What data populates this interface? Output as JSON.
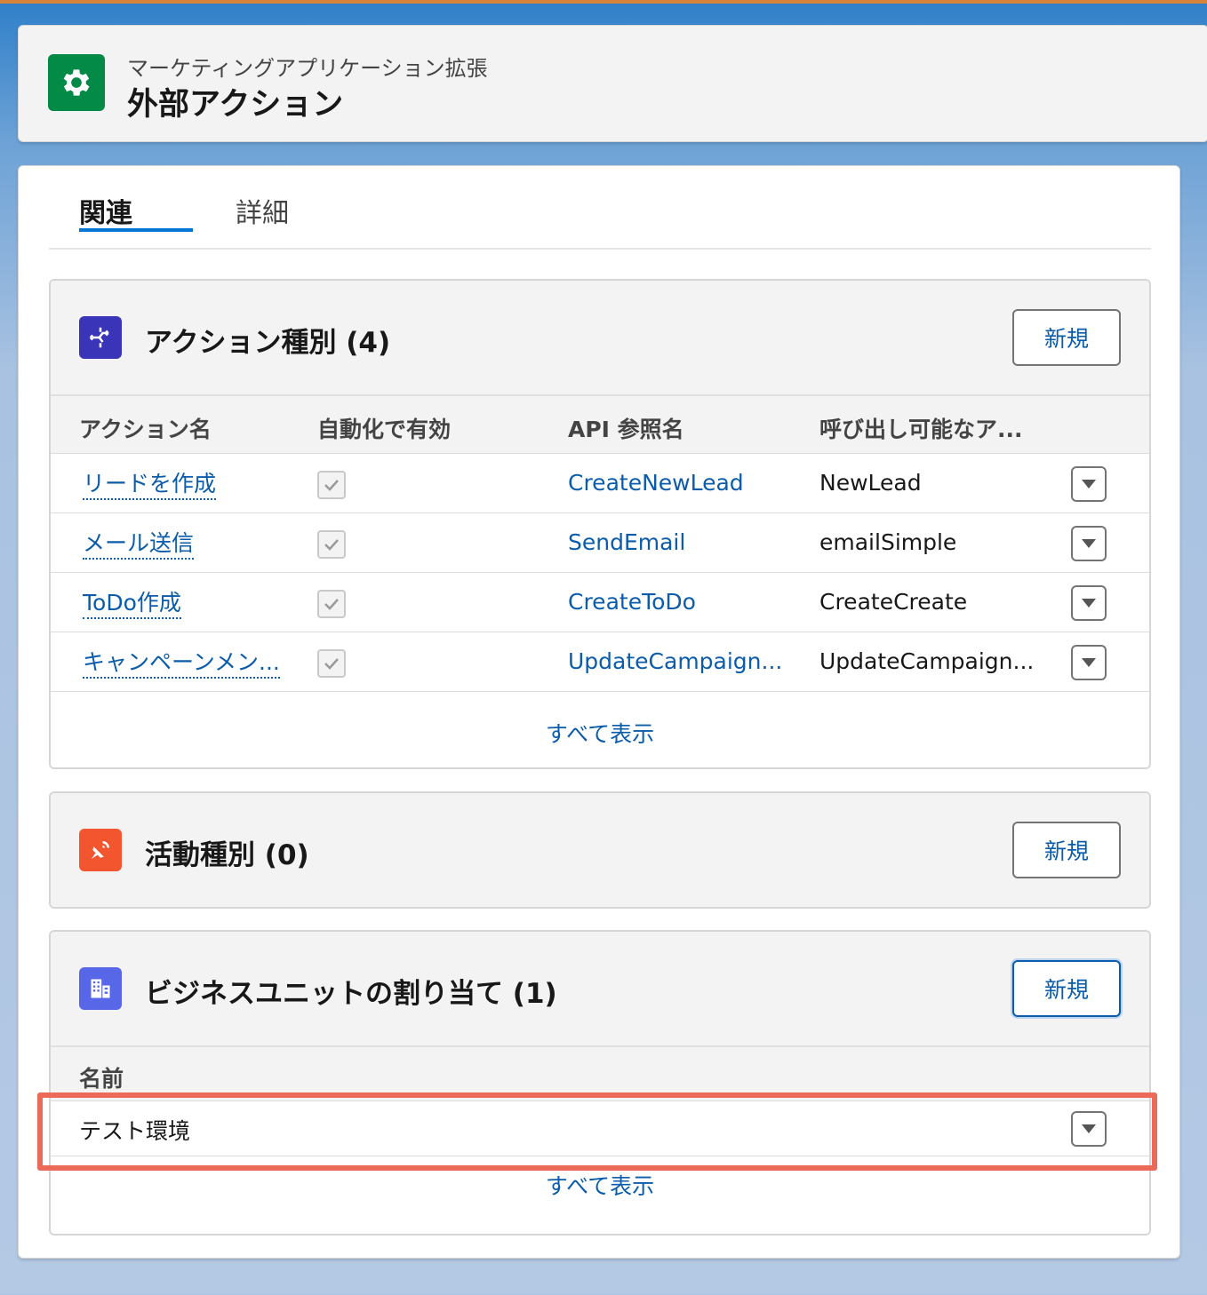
{
  "header": {
    "eyebrow": "マーケティングアプリケーション拡張",
    "title": "外部アクション",
    "icon": "gear-icon",
    "icon_color": "#048a47"
  },
  "tabs": [
    {
      "label": "関連",
      "active": true
    },
    {
      "label": "詳細",
      "active": false
    }
  ],
  "action_types": {
    "title": "アクション種別 (4)",
    "icon": "flow-icon",
    "icon_color": "#3a35b8",
    "new_label": "新規",
    "columns": [
      "アクション名",
      "自動化で有効",
      "API 参照名",
      "呼び出し可能なア..."
    ],
    "rows": [
      {
        "name": "リードを作成",
        "enabled": true,
        "api_name": "CreateNewLead",
        "invocable": "NewLead"
      },
      {
        "name": "メール送信",
        "enabled": true,
        "api_name": "SendEmail",
        "invocable": "emailSimple"
      },
      {
        "name": "ToDo作成",
        "enabled": true,
        "api_name": "CreateToDo",
        "invocable": "CreateCreate"
      },
      {
        "name": "キャンペーンメン...",
        "enabled": true,
        "api_name": "UpdateCampaign...",
        "invocable": "UpdateCampaign..."
      }
    ],
    "view_all": "すべて表示"
  },
  "activity_types": {
    "title": "活動種別 (0)",
    "icon": "satellite-icon",
    "icon_color": "#f3562f",
    "new_label": "新規"
  },
  "business_units": {
    "title": "ビジネスユニットの割り当て (1)",
    "icon": "building-icon",
    "icon_color": "#5867e8",
    "new_label": "新規",
    "columns": [
      "名前"
    ],
    "rows": [
      {
        "name": "テスト環境"
      }
    ],
    "view_all": "すべて表示"
  },
  "colors": {
    "link": "#0b5cab",
    "tab_active_underline": "#0176d3",
    "highlight": "#ec6a5a"
  }
}
